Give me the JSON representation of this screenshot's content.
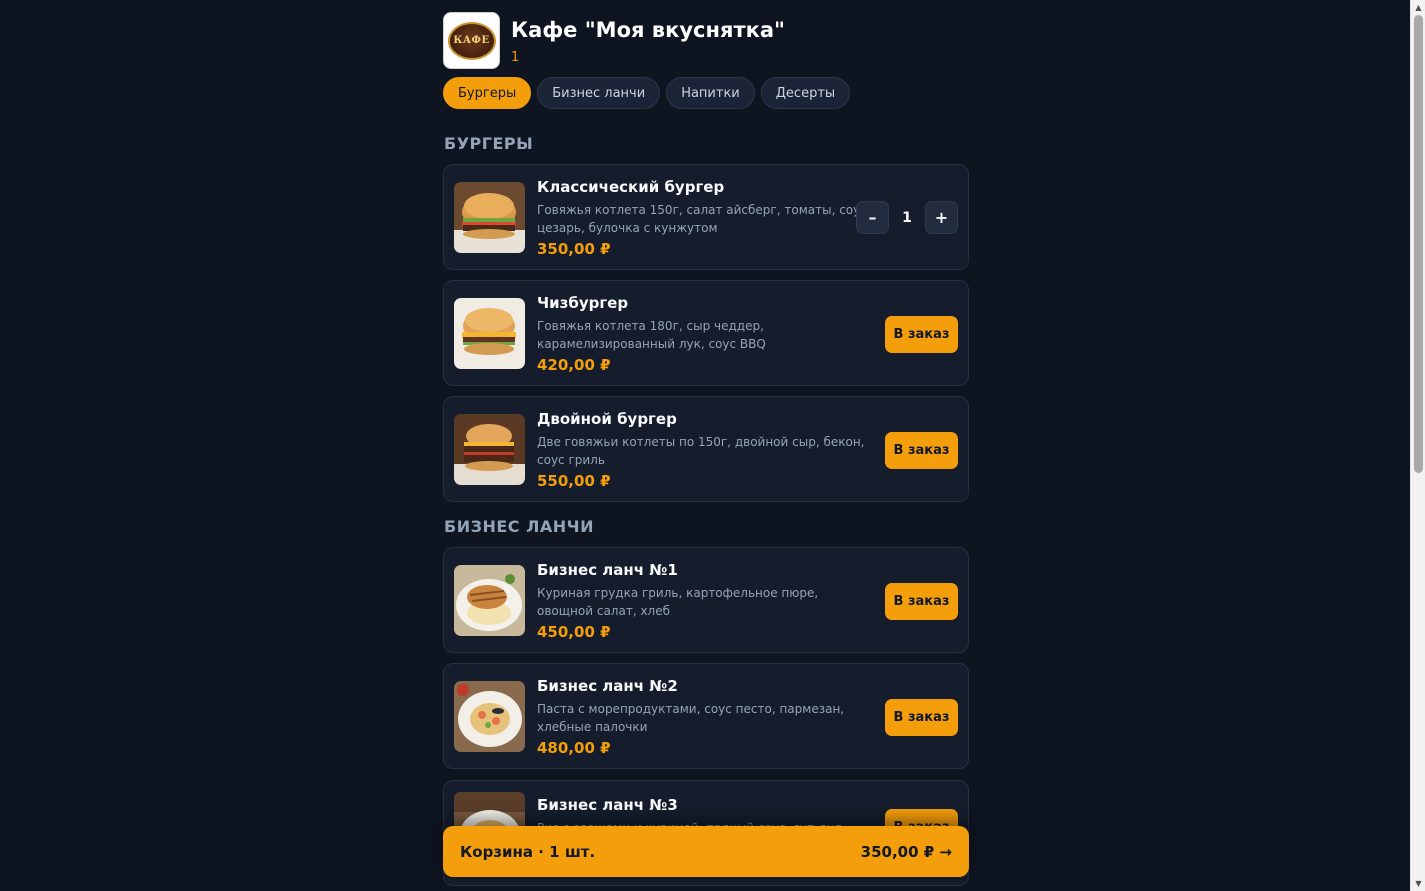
{
  "header": {
    "logo_text": "КАФЕ",
    "title": "Кафе \"Моя вкуснятка\"",
    "subtitle": "1"
  },
  "tabs": [
    {
      "label": "Бургеры",
      "active": true
    },
    {
      "label": "Бизнес ланчи",
      "active": false
    },
    {
      "label": "Напитки",
      "active": false
    },
    {
      "label": "Десерты",
      "active": false
    }
  ],
  "sections": [
    {
      "title": "БУРГЕРЫ"
    },
    {
      "title": "БИЗНЕС ЛАНЧИ"
    }
  ],
  "items": [
    {
      "name": "Классический бургер",
      "desc": "Говяжья котлета 150г, салат айсберг, томаты, соус цезарь, булочка с кунжутом",
      "price": "350,00 ₽",
      "in_cart": true,
      "qty": "1",
      "image": "burger-image"
    },
    {
      "name": "Чизбургер",
      "desc": "Говяжья котлета 180г, сыр чеддер, карамелизированный лук, соус BBQ",
      "price": "420,00 ₽",
      "in_cart": false,
      "image": "burger-image"
    },
    {
      "name": "Двойной бургер",
      "desc": "Две говяжьи котлеты по 150г, двойной сыр, бекон, соус гриль",
      "price": "550,00 ₽",
      "in_cart": false,
      "image": "burger-image"
    },
    {
      "name": "Бизнес ланч №1",
      "desc": "Куриная грудка гриль, картофельное пюре, овощной салат, хлеб",
      "price": "450,00 ₽",
      "in_cart": false,
      "image": "chicken-plate-image"
    },
    {
      "name": "Бизнес ланч №2",
      "desc": "Паста с морепродуктами, соус песто, пармезан, хлебные палочки",
      "price": "480,00 ₽",
      "in_cart": false,
      "image": "pasta-plate-image"
    },
    {
      "name": "Бизнес ланч №3",
      "desc": "Рис с овощами и курицей, пряный соус, суп дня, хлеб",
      "price": "",
      "in_cart": false,
      "image": "rice-plate-image"
    }
  ],
  "buttons": {
    "order_label": "В заказ",
    "minus": "–",
    "plus": "+"
  },
  "cart": {
    "summary": "Корзина · 1 шт.",
    "total": "350,00 ₽ →"
  },
  "colors": {
    "background": "#0e1420",
    "card": "#151d2c",
    "accent": "#f59e0b",
    "muted_text": "#94a3b8"
  }
}
